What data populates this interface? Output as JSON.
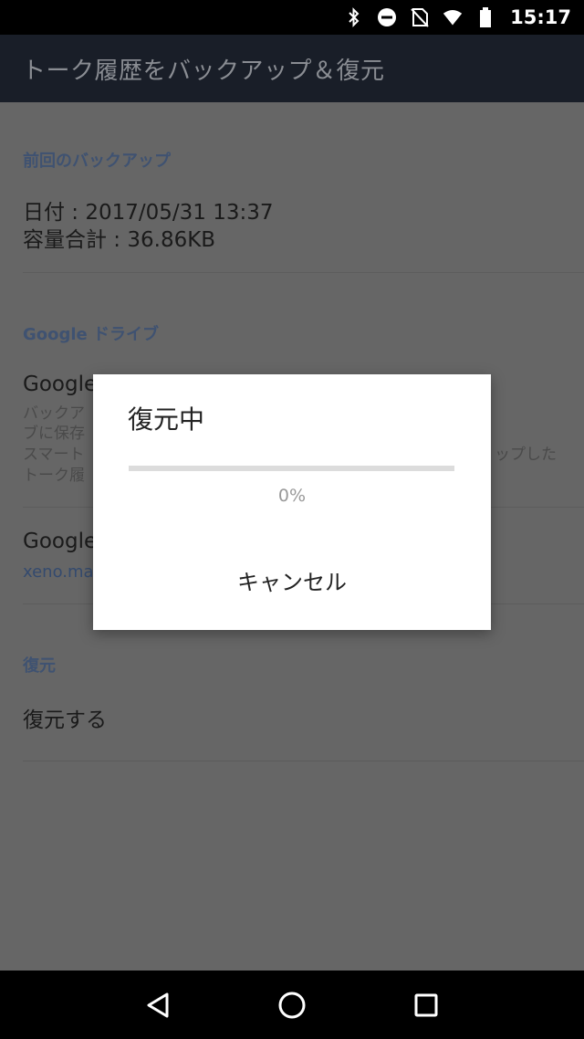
{
  "status_bar": {
    "time": "15:17",
    "icons": [
      "bluetooth-icon",
      "do-not-disturb-icon",
      "no-sim-icon",
      "wifi-icon",
      "battery-icon"
    ]
  },
  "toolbar": {
    "title": "トーク履歴をバックアップ＆復元"
  },
  "sections": {
    "last_backup": {
      "header": "前回のバックアップ",
      "date_line": "日付 : 2017/05/31 13:37",
      "size_line": "容量合計 : 36.86KB"
    },
    "google_drive": {
      "header": "Google ドライブ",
      "item1_title": "Google",
      "item1_desc_lines": [
        "バックア",
        "ブに保存",
        "スマート",
        "トーク履"
      ],
      "item1_desc_right": "ップした",
      "item2_title": "Google",
      "item2_account": "xeno.ma"
    },
    "restore": {
      "header": "復元",
      "item_label": "復元する"
    }
  },
  "dialog": {
    "title": "復元中",
    "progress_percent": 0,
    "progress_text": "0%",
    "cancel_label": "キャンセル"
  },
  "nav_bar": {
    "icons": [
      "back-icon",
      "home-icon",
      "recents-icon"
    ]
  },
  "colors": {
    "section_header": "#3f5271",
    "toolbar_bg": "#191e28",
    "dim_background": "#666666"
  }
}
